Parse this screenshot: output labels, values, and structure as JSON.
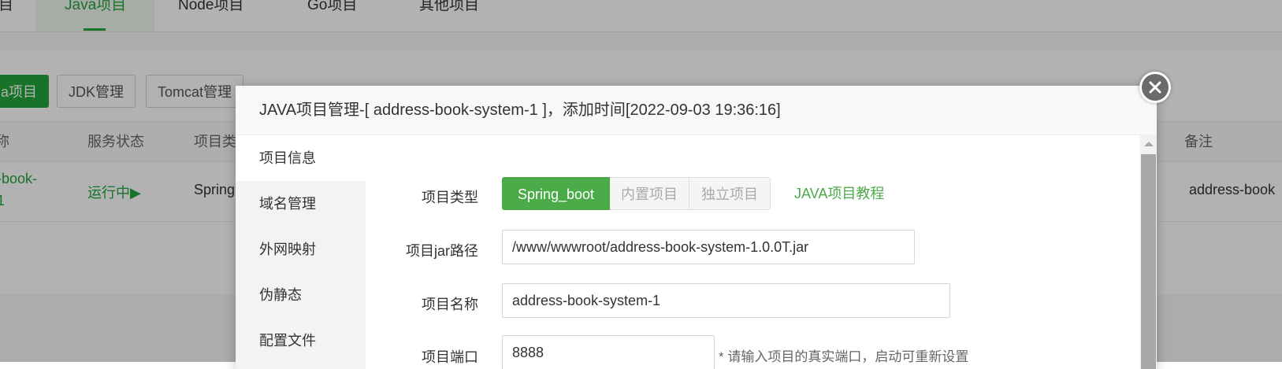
{
  "nav": {
    "tabs": [
      {
        "label": "目"
      },
      {
        "label": "Java项目"
      },
      {
        "label": "Node项目"
      },
      {
        "label": "Go项目"
      },
      {
        "label": "其他项目"
      }
    ]
  },
  "toolbar": {
    "add_label": "a项目",
    "jdk_label": "JDK管理",
    "tomcat_label": "Tomcat管理"
  },
  "table": {
    "headers": {
      "name": "称",
      "status": "服务状态",
      "type": "项目类",
      "remark": "备注"
    },
    "row": {
      "name_line1": "-book-",
      "name_line2": "1",
      "status": "运行中▶",
      "type": "Spring",
      "remark": "address-book"
    }
  },
  "modal": {
    "title": "JAVA项目管理-[ address-book-system-1 ]，添加时间[2022-09-03 19:36:16]",
    "sidebar": [
      {
        "label": "项目信息",
        "active": true
      },
      {
        "label": "域名管理"
      },
      {
        "label": "外网映射"
      },
      {
        "label": "伪静态"
      },
      {
        "label": "配置文件"
      }
    ],
    "form": {
      "type_label": "项目类型",
      "type_options": [
        "Spring_boot",
        "内置项目",
        "独立项目"
      ],
      "selected_type": "Spring_boot",
      "tutorial_link": "JAVA项目教程",
      "jar_label": "项目jar路径",
      "jar_value": "/www/wwwroot/address-book-system-1.0.0T.jar",
      "name_label": "项目名称",
      "name_value": "address-book-system-1",
      "port_label": "项目端口",
      "port_value": "8888",
      "port_hint": "* 请输入项目的真实端口，启动可重新设置"
    }
  },
  "colors": {
    "accent": "#20a53a",
    "segment_active": "#4cab49",
    "overlay": "rgba(0,0,0,0.3)"
  },
  "icons": {
    "close": "close-icon",
    "scroll_up": "scroll-up-arrow-icon"
  }
}
